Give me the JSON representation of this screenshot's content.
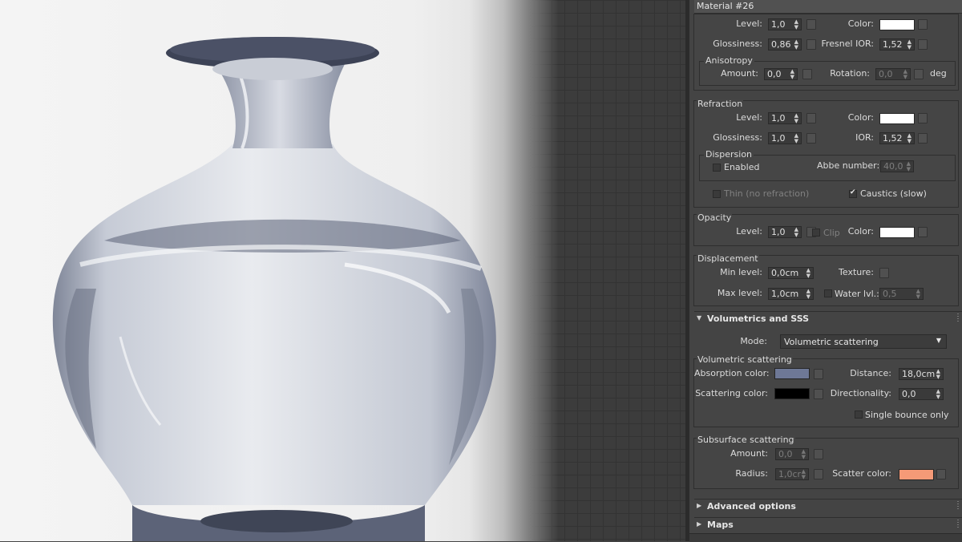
{
  "window": {
    "title": "Material #26"
  },
  "reflection": {
    "level_label": "Level:",
    "level": "1,0",
    "color_label": "Color:",
    "color": "#ffffff",
    "glossiness_label": "Glossiness:",
    "glossiness": "0,86",
    "fresnel_label": "Fresnel IOR:",
    "fresnel_ior": "1,52",
    "anisotropy": {
      "title": "Anisotropy",
      "amount_label": "Amount:",
      "amount": "0,0",
      "rotation_label": "Rotation:",
      "rotation": "0,0",
      "rotation_unit": "deg"
    }
  },
  "refraction": {
    "title": "Refraction",
    "level_label": "Level:",
    "level": "1,0",
    "color_label": "Color:",
    "color": "#ffffff",
    "glossiness_label": "Glossiness:",
    "glossiness": "1,0",
    "ior_label": "IOR:",
    "ior": "1,52",
    "dispersion": {
      "title": "Dispersion",
      "enabled_label": "Enabled",
      "enabled": false,
      "abbe_label": "Abbe number:",
      "abbe": "40,0"
    },
    "thin_label": "Thin (no refraction)",
    "thin": false,
    "caustics_label": "Caustics (slow)",
    "caustics": true
  },
  "opacity": {
    "title": "Opacity",
    "level_label": "Level:",
    "level": "1,0",
    "clip_label": "Clip",
    "clip": false,
    "color_label": "Color:",
    "color": "#ffffff"
  },
  "displacement": {
    "title": "Displacement",
    "min_label": "Min level:",
    "min_level": "0,0cm",
    "texture_label": "Texture:",
    "max_label": "Max level:",
    "max_level": "1,0cm",
    "water_label": "Water lvl.:",
    "water_level": "0,5"
  },
  "volumetrics": {
    "rollout_title": "Volumetrics and SSS",
    "mode_label": "Mode:",
    "mode": "Volumetric scattering",
    "scattering": {
      "title": "Volumetric scattering",
      "absorption_label": "Absorption color:",
      "absorption_color": "#6e7896",
      "distance_label": "Distance:",
      "distance": "18,0cm",
      "scattering_label": "Scattering color:",
      "scattering_color": "#000000",
      "directionality_label": "Directionality:",
      "directionality": "0,0",
      "single_bounce_label": "Single bounce only",
      "single_bounce": false
    },
    "subsurface": {
      "title": "Subsurface scattering",
      "amount_label": "Amount:",
      "amount": "0,0",
      "radius_label": "Radius:",
      "radius": "1,0cr",
      "scatter_color_label": "Scatter color:",
      "scatter_color": "#f59a77"
    }
  },
  "rollouts": {
    "advanced": "Advanced options",
    "maps": "Maps"
  }
}
